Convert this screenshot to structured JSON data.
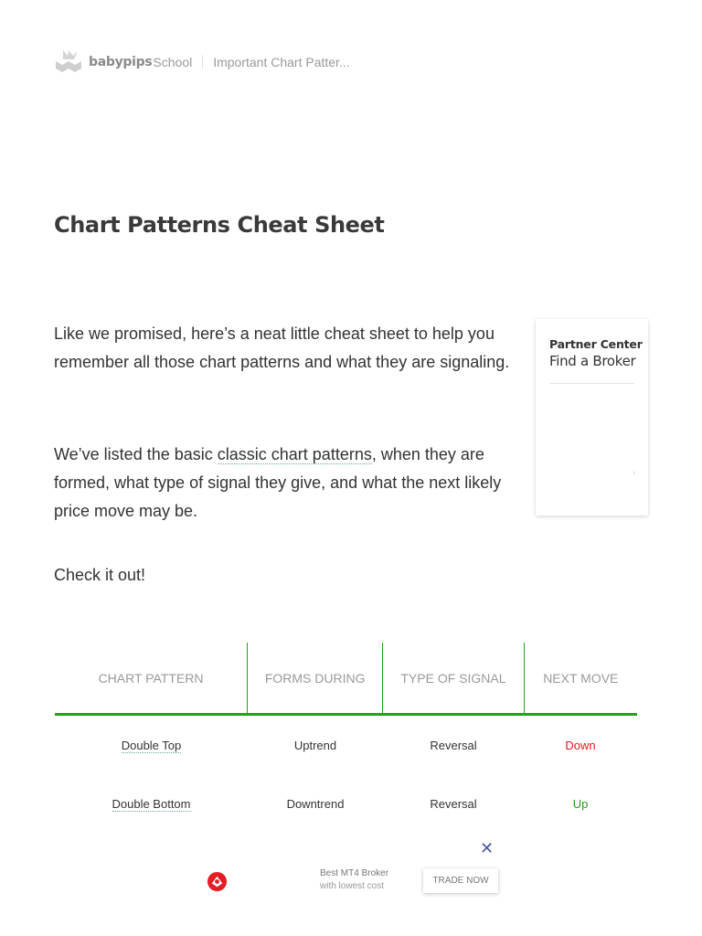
{
  "header": {
    "logo_text": "babypips",
    "logo_sub": "School",
    "breadcrumb": "Important Chart Patter..."
  },
  "article": {
    "title": "Chart Patterns Cheat Sheet",
    "p1": "Like we promised, here’s a neat little cheat sheet to help you remember all those chart patterns and what they are signaling.",
    "p2_before": "We’ve listed the basic ",
    "p2_link": "classic chart patterns",
    "p2_after": ", when they are formed, what type of signal they give, and what the next likely price move may be.",
    "p3": "Check it out!"
  },
  "sidebar": {
    "partner_title": "Partner Center",
    "partner_link": "Find a Broker"
  },
  "table": {
    "headers": [
      "CHART PATTERN",
      "FORMS DURING",
      "TYPE OF SIGNAL",
      "NEXT MOVE"
    ],
    "rows": [
      {
        "pattern": "Double Top",
        "forms": "Uptrend",
        "signal": "Reversal",
        "move": "Down"
      },
      {
        "pattern": "Double Bottom",
        "forms": "Downtrend",
        "signal": "Reversal",
        "move": "Up"
      }
    ]
  },
  "ad": {
    "title": "Best MT4 Broker",
    "subtitle": "with lowest cost",
    "button": "TRADE NOW",
    "close_icon": "close-icon"
  },
  "colors": {
    "accent_green": "#28a01e",
    "down_red": "#e21b1b",
    "up_green": "#2a9a1e",
    "close_blue": "#4a56a8"
  }
}
